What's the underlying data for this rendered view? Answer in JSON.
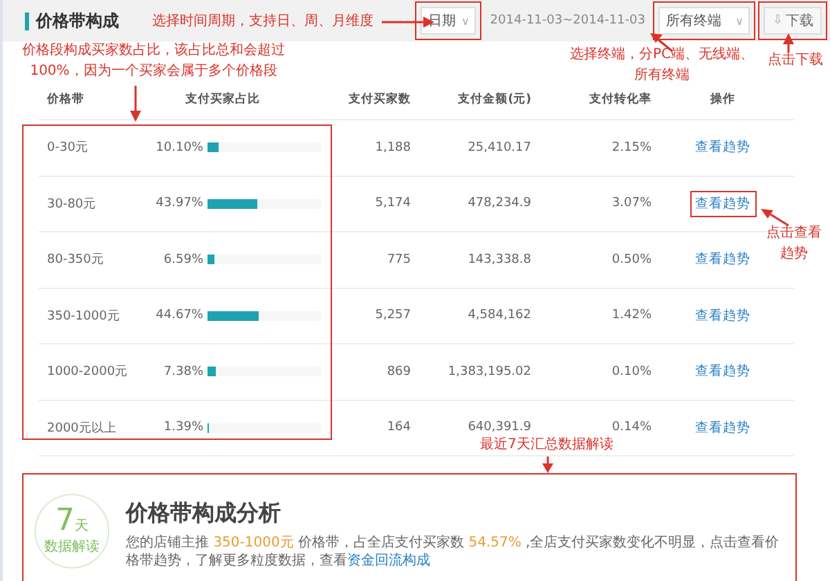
{
  "header": {
    "title": "价格带构成",
    "date_select": {
      "value": "日期",
      "caret": "∨"
    },
    "date_range": "2014-11-03~2014-11-03",
    "terminal_select": {
      "value": "所有终端",
      "caret": "∨"
    },
    "download": {
      "icon": "⇩",
      "label": "下载"
    }
  },
  "table": {
    "columns": [
      "价格带",
      "支付买家占比",
      "支付买家数",
      "支付金额(元)",
      "支付转化率",
      "操作"
    ],
    "rows": [
      {
        "band": "0-30元",
        "share": "10.10%",
        "level": 0.101,
        "buyers": "1,188",
        "amount": "25,410.17",
        "rate": "2.15%",
        "action": "查看趋势",
        "highlighted": false
      },
      {
        "band": "30-80元",
        "share": "43.97%",
        "level": 0.4397,
        "buyers": "5,174",
        "amount": "478,234.9",
        "rate": "3.07%",
        "action": "查看趋势",
        "highlighted": true
      },
      {
        "band": "80-350元",
        "share": "6.59%",
        "level": 0.0659,
        "buyers": "775",
        "amount": "143,338.8",
        "rate": "0.50%",
        "action": "查看趋势",
        "highlighted": false
      },
      {
        "band": "350-1000元",
        "share": "44.67%",
        "level": 0.4467,
        "buyers": "5,257",
        "amount": "4,584,162",
        "rate": "1.42%",
        "action": "查看趋势",
        "highlighted": false
      },
      {
        "band": "1000-2000元",
        "share": "7.38%",
        "level": 0.0738,
        "buyers": "869",
        "amount": "1,383,195.02",
        "rate": "0.10%",
        "action": "查看趋势",
        "highlighted": false
      },
      {
        "band": "2000元以上",
        "share": "1.39%",
        "level": 0.0139,
        "buyers": "164",
        "amount": "640,391.9",
        "rate": "0.14%",
        "action": "查看趋势",
        "highlighted": false
      }
    ]
  },
  "summary": {
    "badge": {
      "number": "7",
      "unit": "天",
      "caption": "数据解读"
    },
    "title": "价格带构成分析",
    "sentence": [
      {
        "kind": "plain",
        "text": "您的店铺主推 "
      },
      {
        "kind": "highlight",
        "text": "350-1000元"
      },
      {
        "kind": "plain",
        "text": " 价格带，占全店支付买家数 "
      },
      {
        "kind": "highlight",
        "text": "54.57%"
      },
      {
        "kind": "plain",
        "text": " ,全店支付买家数变化不明显，点击查看价格带趋势，了解更多粒度数据，查看"
      },
      {
        "kind": "link",
        "text": "资金回流构成"
      }
    ]
  },
  "annotations": [
    {
      "lines": [
        "选择时间周期，支持日、周、月维度"
      ]
    },
    {
      "lines": [
        "价格段构成买家数占比，该占比总和会超过",
        "100%，因为一个买家会属于多个价格段"
      ]
    },
    {
      "lines": [
        "选择终端，分PC端、无线端、",
        "所有终端"
      ]
    },
    {
      "lines": [
        "点击下载"
      ]
    },
    {
      "lines": [
        "点击查看",
        "趋势"
      ]
    },
    {
      "lines": [
        "最近7天汇总数据解读"
      ]
    }
  ]
}
